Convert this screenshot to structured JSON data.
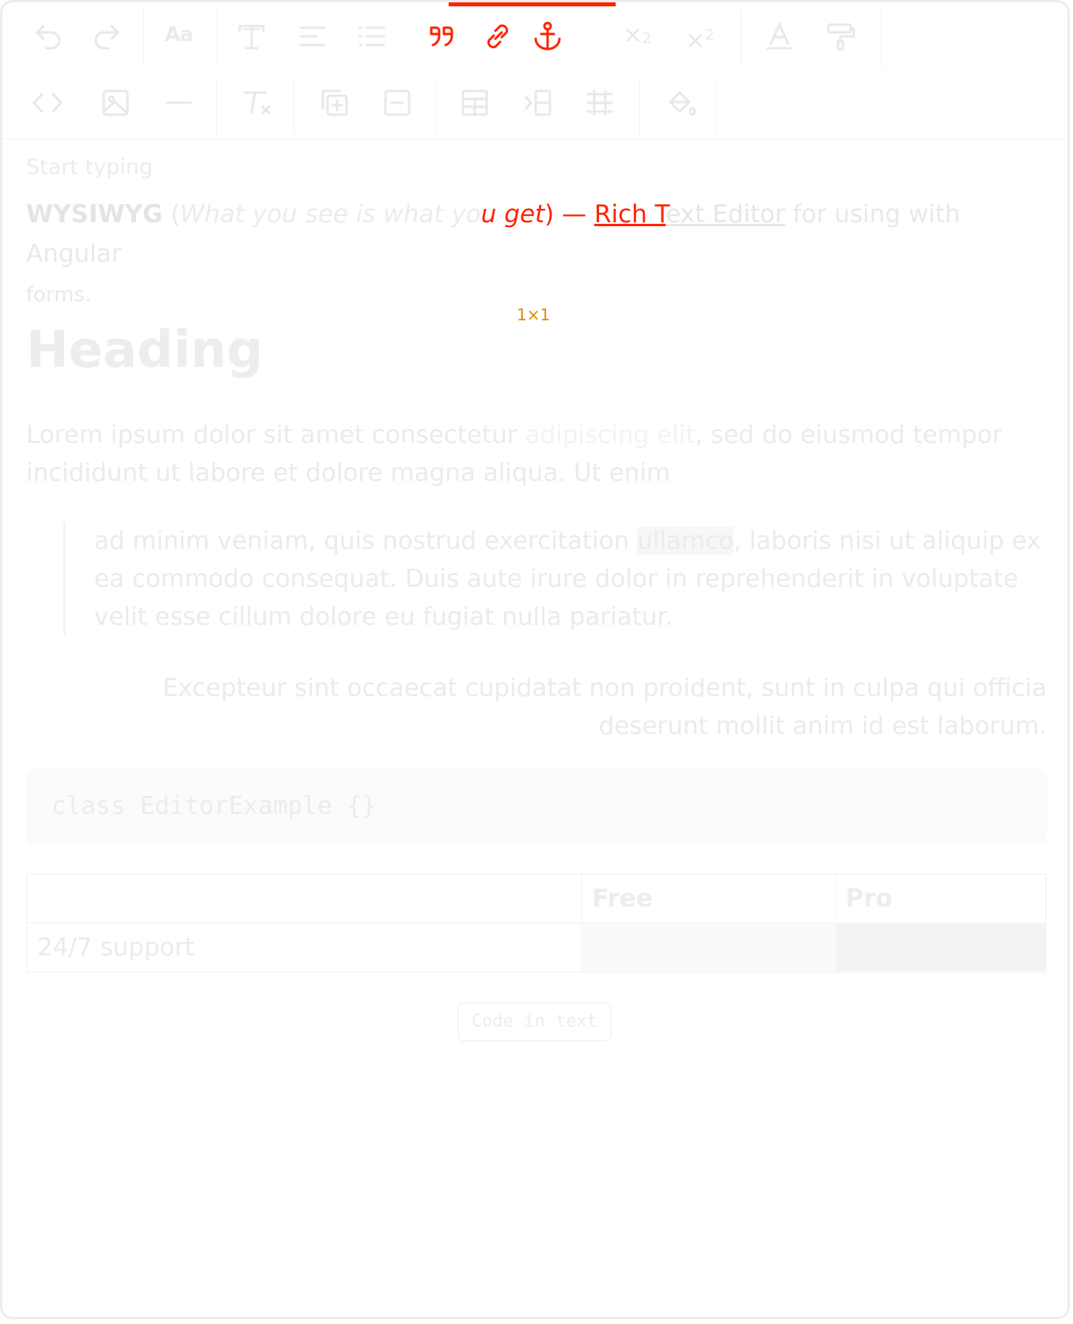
{
  "toolbar": {
    "row1": [
      {
        "name": "undo-button",
        "icon": "undo-icon"
      },
      {
        "name": "redo-button",
        "icon": "redo-icon"
      },
      {
        "name": "font-size-button",
        "icon": "font-size-icon",
        "label": "Aa"
      },
      {
        "name": "text-style-button",
        "icon": "text-style-icon"
      },
      {
        "name": "align-button",
        "icon": "align-left-icon"
      },
      {
        "name": "list-button",
        "icon": "bulleted-list-icon"
      },
      {
        "name": "quote-button",
        "icon": "quote-icon"
      },
      {
        "name": "link-button",
        "icon": "link-icon"
      },
      {
        "name": "anchor-button",
        "icon": "anchor-icon"
      },
      {
        "name": "subscript-button",
        "icon": "subscript-icon"
      },
      {
        "name": "superscript-button",
        "icon": "superscript-icon"
      },
      {
        "name": "font-color-button",
        "icon": "font-color-icon"
      },
      {
        "name": "highlight-button",
        "icon": "paint-roller-icon"
      }
    ],
    "row2": [
      {
        "name": "code-button",
        "icon": "code-icon"
      },
      {
        "name": "image-button",
        "icon": "image-icon"
      },
      {
        "name": "horizontal-rule-button",
        "icon": "horizontal-rule-icon"
      },
      {
        "name": "clear-format-button",
        "icon": "clear-format-icon"
      },
      {
        "name": "insert-group-button",
        "icon": "add-group-icon"
      },
      {
        "name": "remove-group-button",
        "icon": "remove-group-icon"
      },
      {
        "name": "insert-table-button",
        "icon": "table-icon"
      },
      {
        "name": "insert-row-button",
        "icon": "table-row-icon"
      },
      {
        "name": "insert-column-button",
        "icon": "table-column-icon"
      },
      {
        "name": "cell-color-button",
        "icon": "paint-bucket-icon"
      }
    ],
    "active_color": "#ff2200"
  },
  "content": {
    "placeholder": "Start typing",
    "intro": {
      "bold": "WYSIWYG",
      "open_paren": " (",
      "italic_faded": "What you see is what yo",
      "italic_highlight": "u get",
      "close_dash": ") — ",
      "link_highlight": "Rich T",
      "link_faded": "ext Editor",
      "tail": " for using with Angular",
      "forms": "forms."
    },
    "cursor_label": "1×1",
    "heading": "Heading",
    "paragraph": {
      "start": "Lorem ipsum dolor sit amet consectetur ",
      "muted": "adipiscing elit",
      "end": ", sed do eiusmod tempor incididunt ut labore et dolore magna aliqua. Ut enim"
    },
    "quote": {
      "start": "ad minim veniam, quis nostrud exercitation ",
      "mark": "ullamco",
      "end": ", laboris nisi ut aliquip ex ea commodo consequat. Duis aute irure dolor in reprehenderit in voluptate velit esse cillum dolore eu fugiat nulla pariatur."
    },
    "right_paragraph": "Excepteur sint occaecat cupidatat non proident, sunt in culpa qui officia deserunt mollit anim id est laborum.",
    "code_block": "class EditorExample {}",
    "table": {
      "headers": [
        "",
        "Free",
        "Pro"
      ],
      "rows": [
        [
          "24/7 support",
          "",
          ""
        ]
      ]
    },
    "inline_code": "Code in text"
  }
}
